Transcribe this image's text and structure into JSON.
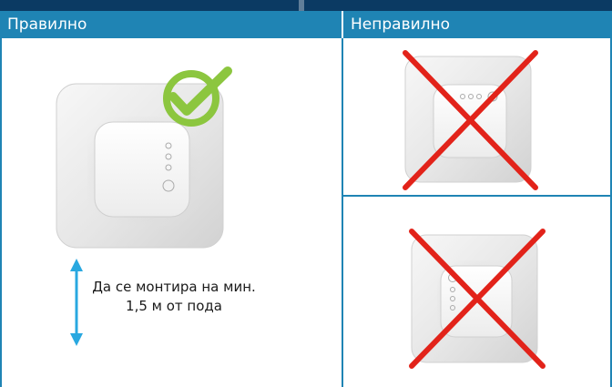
{
  "table": {
    "header_correct": "Правилно",
    "header_incorrect": "Неправилно"
  },
  "caption": {
    "line1": "Да се монтира на мин.",
    "line2": "1,5 м от пода"
  },
  "icons": {
    "correct": "check-circle-icon",
    "incorrect": "red-cross-icon",
    "height": "double-arrow-vertical-icon"
  },
  "colors": {
    "header_bg": "#1f84b4",
    "top_bar": "#0b3a63",
    "check_green": "#8cc63f",
    "cross_red": "#e2231a",
    "arrow_blue": "#29a8e0"
  }
}
